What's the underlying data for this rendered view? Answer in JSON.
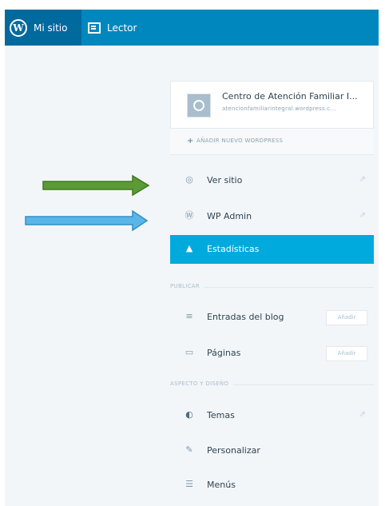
{
  "topbar": {
    "my_site_label": "Mi sitio",
    "reader_label": "Lector"
  },
  "site": {
    "title": "Centro de Atención Familiar I...",
    "url": "atencionfamiliarintegral.wordpress.c..."
  },
  "add_site": {
    "icon": "+",
    "label": "AÑADIR NUEVO WORDPRESS"
  },
  "menu": {
    "view_site": "Ver sitio",
    "wp_admin": "WP Admin",
    "stats": "Estadísticas"
  },
  "publish": {
    "header": "PUBLICAR",
    "posts": "Entradas del blog",
    "posts_add": "Añadir",
    "pages": "Páginas",
    "pages_add": "Añadir"
  },
  "appearance": {
    "header": "ASPECTO Y DISEÑO",
    "themes": "Temas",
    "customize": "Personalizar",
    "menus": "Menús"
  },
  "colors": {
    "topbar": "#0087be",
    "active": "#00aadc",
    "arrow_green": "#5c9a35",
    "arrow_blue": "#5bb6e8"
  }
}
